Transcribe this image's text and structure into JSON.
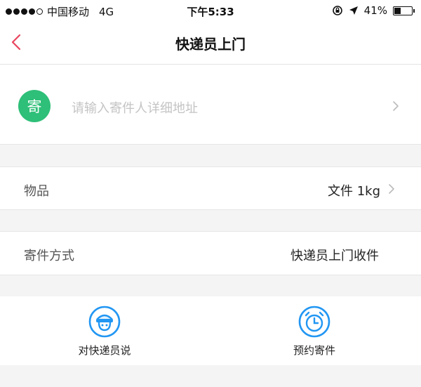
{
  "status_bar": {
    "carrier": "中国移动",
    "network": "4G",
    "time": "下午5:33",
    "battery_percent": "41%",
    "battery_level": 0.41
  },
  "nav": {
    "title": "快递员上门",
    "back_icon": "chevron-left-icon",
    "accent_color": "#e8455e"
  },
  "address": {
    "badge": "寄",
    "badge_color": "#2ebf78",
    "placeholder": "请输入寄件人详细地址",
    "chevron_icon": "chevron-right-icon"
  },
  "item": {
    "label": "物品",
    "value": "文件 1kg",
    "chevron_icon": "chevron-right-icon"
  },
  "method": {
    "label": "寄件方式",
    "value": "快递员上门收件"
  },
  "actions": [
    {
      "label": "对快递员说",
      "icon": "courier-chat-icon"
    },
    {
      "label": "预约寄件",
      "icon": "alarm-clock-icon"
    }
  ],
  "icon_color": "#2196f3"
}
